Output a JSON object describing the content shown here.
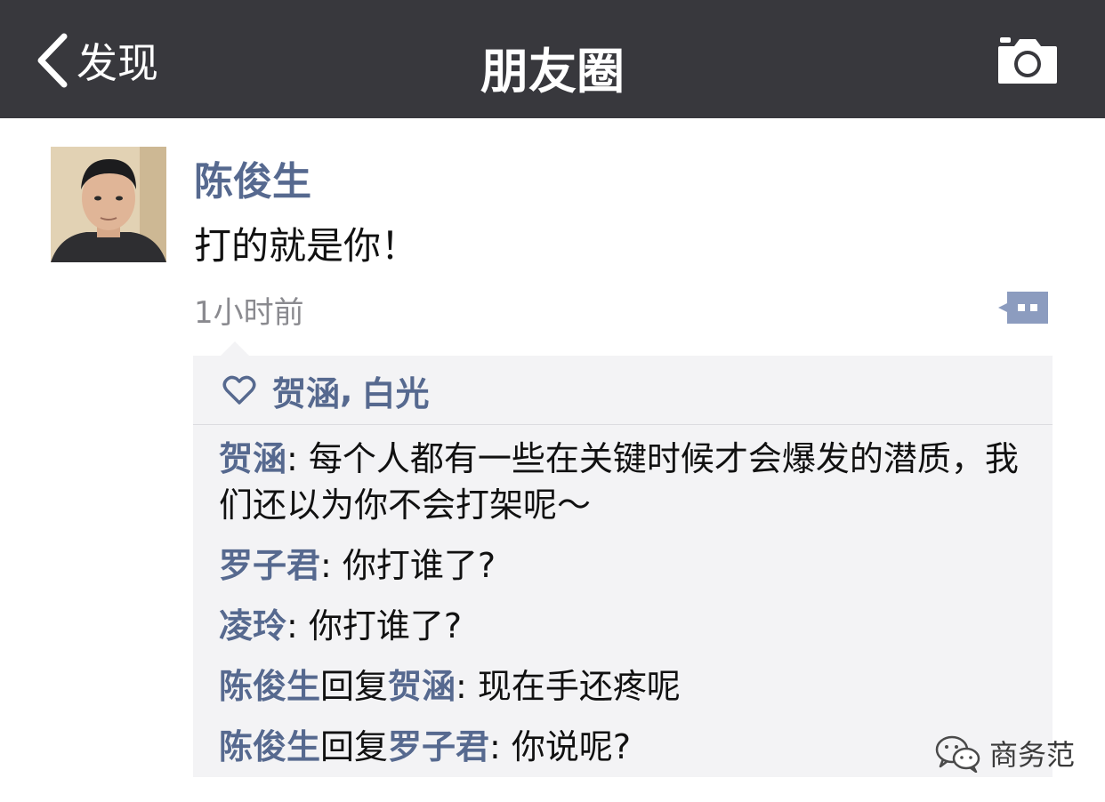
{
  "navbar": {
    "back_label": "发现",
    "title": "朋友圈",
    "back_icon": "chevron-left-icon",
    "camera_icon": "camera-icon"
  },
  "post": {
    "author": "陈俊生",
    "text": "打的就是你！",
    "time": "1小时前",
    "more_icon": "comment-bubble-icon"
  },
  "likes": {
    "icon": "heart-outline-icon",
    "names": [
      "贺涵",
      "白光"
    ],
    "separator": ","
  },
  "comments": [
    {
      "name": "贺涵",
      "text": ": 每个人都有一些在关键时候才会爆发的潜质，我们还以为你不会打架呢～"
    },
    {
      "name": "罗子君",
      "text": ": 你打谁了?"
    },
    {
      "name": "凌玲",
      "text": ": 你打谁了?"
    },
    {
      "name": "陈俊生",
      "reply_word": "回复",
      "reply_to": "贺涵",
      "text": ": 现在手还疼呢"
    },
    {
      "name": "陈俊生",
      "reply_word": "回复",
      "reply_to": "罗子君",
      "text": ": 你说呢?"
    }
  ],
  "watermark": {
    "text": "商务范",
    "icon": "wechat-logo-icon"
  },
  "colors": {
    "navbar_bg": "#38383d",
    "name_link": "#56698f",
    "panel_bg": "#f3f3f5",
    "time_gray": "#8a8a8f"
  }
}
